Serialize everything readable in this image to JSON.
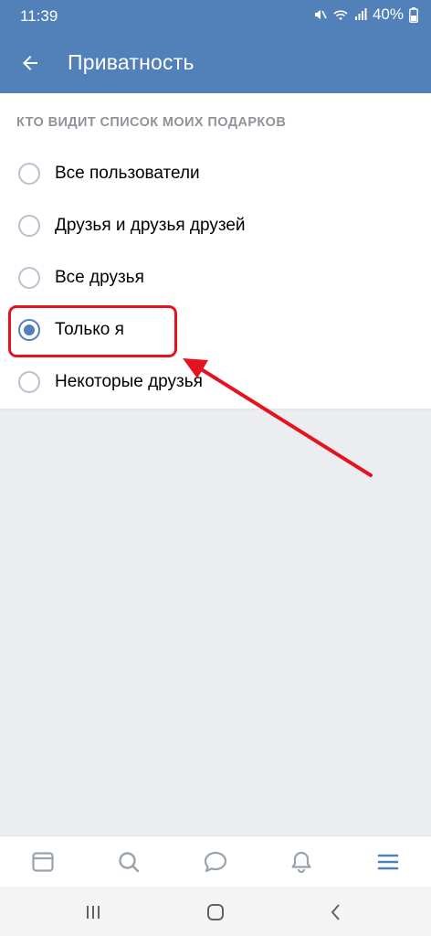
{
  "status_bar": {
    "time": "11:39",
    "battery": "40%",
    "icons": [
      "mute-icon",
      "wifi-icon",
      "signal-icon",
      "battery-icon"
    ]
  },
  "app_bar": {
    "title": "Приватность",
    "back_icon": "arrow-left-icon",
    "background": "#5181b8"
  },
  "section": {
    "header": "КТО ВИДИТ СПИСОК МОИХ ПОДАРКОВ",
    "options": [
      {
        "label": "Все пользователи",
        "checked": false
      },
      {
        "label": "Друзья и друзья друзей",
        "checked": false
      },
      {
        "label": "Все друзья",
        "checked": false
      },
      {
        "label": "Только я",
        "checked": true
      },
      {
        "label": "Некоторые друзья",
        "checked": false
      }
    ]
  },
  "annotation": {
    "color": "#e3141f",
    "highlighted_option": "Только я"
  },
  "tab_bar": {
    "tabs": [
      "news-icon",
      "search-icon",
      "messages-icon",
      "notifications-icon",
      "menu-icon"
    ],
    "active_tab": "menu-icon",
    "accent": "#5181b8"
  },
  "system_nav": [
    "recents-icon",
    "home-icon",
    "back-icon"
  ]
}
